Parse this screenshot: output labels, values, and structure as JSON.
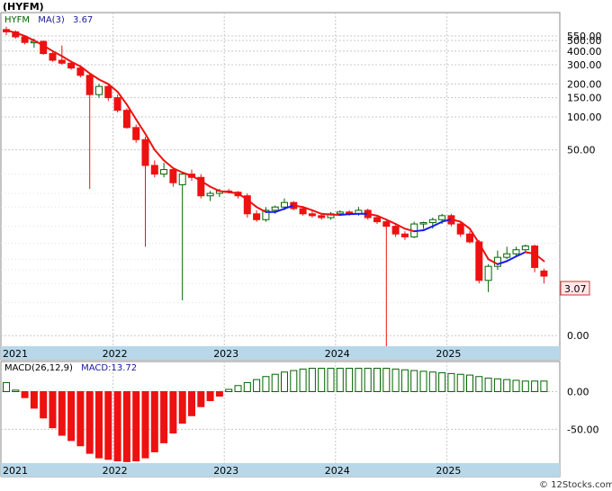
{
  "header": {
    "ticker": "(HYFM)"
  },
  "colors": {
    "up": "#006400",
    "down": "#ee1111",
    "ma_up": "#1a1aee",
    "ma_down": "#ee1111",
    "macd": "#1a1a99",
    "badge_bg": "#ffe8e8",
    "badge_border": "#cc3333",
    "year_band": "#b8d8ea",
    "grid": "#c8c8c8"
  },
  "chart_data": [
    {
      "type": "candlestick",
      "legend": {
        "symbol": "HYFM",
        "ma_label": "MA(3)",
        "ma_value": "3.67"
      },
      "last_price_badge": "3.07",
      "yscale": "log",
      "ylim": [
        0.8,
        900
      ],
      "y_ticks": [
        "550.00",
        "500.00",
        "400.00",
        "300.00",
        "200.00",
        "150.00",
        "100.00",
        "50.00",
        "0.00"
      ],
      "x_labels": [
        "2021",
        "2022",
        "2023",
        "2024",
        "2025"
      ],
      "start_month": "2021-01",
      "candles": [
        [
          630,
          670,
          560,
          600
        ],
        [
          600,
          620,
          520,
          540
        ],
        [
          540,
          560,
          460,
          480
        ],
        [
          480,
          520,
          430,
          490
        ],
        [
          490,
          500,
          370,
          380
        ],
        [
          380,
          400,
          320,
          330
        ],
        [
          330,
          450,
          300,
          310
        ],
        [
          310,
          320,
          270,
          280
        ],
        [
          280,
          290,
          230,
          240
        ],
        [
          240,
          250,
          22,
          160
        ],
        [
          160,
          200,
          150,
          190
        ],
        [
          190,
          200,
          140,
          150
        ],
        [
          150,
          160,
          110,
          115
        ],
        [
          115,
          120,
          78,
          80
        ],
        [
          80,
          85,
          58,
          62
        ],
        [
          62,
          66,
          6.5,
          36
        ],
        [
          36,
          40,
          28,
          30
        ],
        [
          30,
          38,
          28,
          33
        ],
        [
          33,
          34,
          23,
          25
        ],
        [
          24,
          31,
          2.1,
          30
        ],
        [
          30,
          33,
          26,
          28
        ],
        [
          28,
          30,
          18,
          19
        ],
        [
          19,
          21,
          17,
          20
        ],
        [
          20,
          22,
          18.5,
          21
        ],
        [
          21,
          22,
          20,
          20.5
        ],
        [
          20.5,
          21,
          18,
          19
        ],
        [
          19,
          20,
          12,
          13
        ],
        [
          13,
          14,
          11,
          11.5
        ],
        [
          11.5,
          15,
          11,
          14
        ],
        [
          14,
          15.5,
          13,
          15
        ],
        [
          15,
          18,
          14,
          16.5
        ],
        [
          16.5,
          17,
          14,
          14.5
        ],
        [
          14.5,
          15,
          12.5,
          13
        ],
        [
          13,
          14,
          12,
          12.5
        ],
        [
          12.5,
          13,
          11.5,
          12
        ],
        [
          12,
          13.5,
          11.5,
          13
        ],
        [
          13,
          14,
          12.5,
          13.5
        ],
        [
          13.5,
          14,
          12.5,
          13
        ],
        [
          13,
          15,
          12.5,
          14
        ],
        [
          14,
          14.5,
          11.5,
          12
        ],
        [
          12,
          12.5,
          10.5,
          11
        ],
        [
          11,
          11.5,
          0.6,
          10
        ],
        [
          10,
          10.5,
          8,
          8.5
        ],
        [
          8.5,
          9,
          7.5,
          8
        ],
        [
          8,
          11,
          7.8,
          10.5
        ],
        [
          10.5,
          11,
          9.5,
          10.8
        ],
        [
          10.8,
          12,
          9.5,
          11.5
        ],
        [
          11.5,
          13,
          10.5,
          12.5
        ],
        [
          12.5,
          13,
          10,
          10.5
        ],
        [
          10.5,
          11,
          8,
          8.5
        ],
        [
          8.5,
          9,
          7,
          7.2
        ],
        [
          7.2,
          7.5,
          3,
          3.2
        ],
        [
          3.2,
          4.5,
          2.5,
          4.3
        ],
        [
          4.3,
          6,
          4,
          5.2
        ],
        [
          5.2,
          6.5,
          5,
          5.6
        ],
        [
          5.6,
          6.5,
          5.3,
          6.1
        ],
        [
          6.1,
          6.8,
          5.8,
          6.6
        ],
        [
          6.6,
          6.8,
          3.8,
          4.2
        ],
        [
          3.9,
          4.1,
          3,
          3.5
        ]
      ],
      "ma": [
        620,
        590,
        550,
        500,
        450,
        400,
        360,
        320,
        290,
        250,
        220,
        200,
        170,
        130,
        95,
        70,
        50,
        40,
        34,
        31,
        29,
        26,
        23,
        21,
        20.5,
        20,
        17.5,
        15,
        13.5,
        13.5,
        14.5,
        15.5,
        15,
        14,
        13,
        12.8,
        12.7,
        12.9,
        13,
        13,
        12.5,
        11.5,
        10.5,
        9.5,
        9,
        9.2,
        10,
        11,
        11.6,
        11,
        9.5,
        7,
        5,
        4.5,
        4.8,
        5.3,
        5.8,
        5.6,
        4.8
      ]
    },
    {
      "type": "bar",
      "legend": {
        "label": "MACD(26,12,9)",
        "value": "MACD:13.72"
      },
      "ylim": [
        -95,
        40
      ],
      "y_ticks": [
        "0.00",
        "-50.00"
      ],
      "y_tick_values": [
        0,
        -50
      ],
      "x_labels": [
        "2021",
        "2022",
        "2023",
        "2024",
        "2025"
      ],
      "values": [
        12,
        2,
        -8,
        -22,
        -35,
        -48,
        -58,
        -65,
        -72,
        -82,
        -88,
        -90,
        -92,
        -93,
        -92,
        -88,
        -80,
        -68,
        -55,
        -42,
        -32,
        -20,
        -12,
        -6,
        3,
        8,
        12,
        16,
        20,
        23,
        26,
        28,
        30,
        31,
        31,
        31,
        31,
        31,
        31,
        31,
        31,
        31,
        30,
        29,
        28,
        27,
        26,
        25,
        24,
        23,
        22,
        20,
        18,
        17,
        16,
        15,
        14,
        14,
        14
      ]
    }
  ],
  "watermark": "© 12Stocks.com"
}
